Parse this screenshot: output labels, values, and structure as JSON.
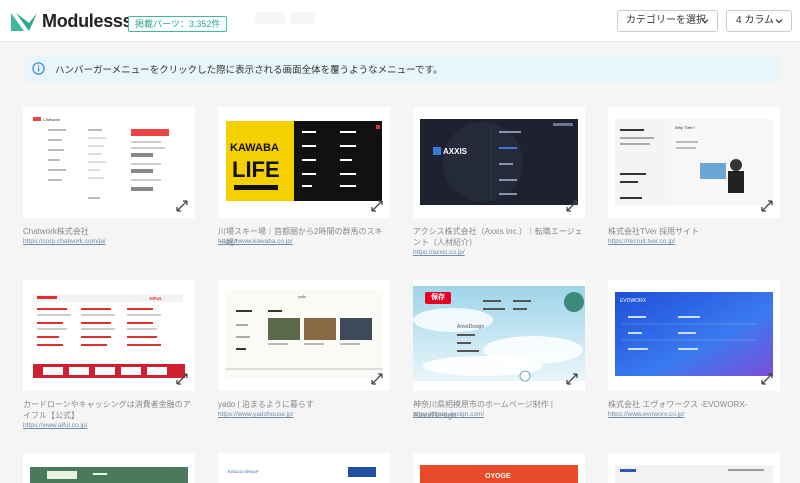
{
  "header": {
    "logo": "Modulesss...",
    "count_badge": "掲載パーツ：3,352件",
    "category_select": "カテゴリーを選択",
    "columns_select": "4 カラム"
  },
  "info": {
    "text": "ハンバーガーメニューをクリックした際に表示される画面全体を覆うようなメニューです。"
  },
  "cards": [
    {
      "title": "Chatwork株式会社",
      "url": "https://corp.chatwork.com/ja/",
      "thumb_label": "Chatwork"
    },
    {
      "title": "川場スキー場｜首都圏から2時間の群馬のスキー場！",
      "url": "https://www.kawaba.co.jp/",
      "thumb_label": "KAWABA LIFE"
    },
    {
      "title": "アクシス株式会社（Axxis Inc.）｜転職エージェント（人材紹介）",
      "url": "https://axxis.co.jp/",
      "thumb_label": "AXXIS"
    },
    {
      "title": "株式会社TVer 採用サイト",
      "url": "https://recruit.tver.co.jp/",
      "thumb_label": "Why TVer?"
    },
    {
      "title": "カードローンやキャッシングは消費者金融のアイフル【公式】",
      "url": "https://www.aiful.co.jp/",
      "thumb_label": "AIFUL"
    },
    {
      "title": "yado | 泊まるように暮らす",
      "url": "https://www.yadohouse.jp/",
      "thumb_label": "yado"
    },
    {
      "title": "神奈川県相模原市のホームページ制作 | AmotDesign",
      "url": "https://amot-design.com/",
      "thumb_label": "AmotDesign",
      "pin_label": "保存"
    },
    {
      "title": "株式会社 エヴォワークス -EVOWORX-",
      "url": "https://www.evoworx.co.jp/",
      "thumb_label": "EVOWORX"
    },
    {
      "title": "",
      "url": "",
      "thumb_label": ""
    },
    {
      "title": "",
      "url": "",
      "thumb_label": "KITAGO GROUP"
    },
    {
      "title": "",
      "url": "",
      "thumb_label": "OYOGE"
    },
    {
      "title": "",
      "url": "",
      "thumb_label": ""
    }
  ],
  "colors": {
    "accent": "#3cb9a0",
    "info_bg": "#e8f5fb",
    "link": "#6b8fb0"
  },
  "icons": [
    "logo-mark-icon",
    "chevron-down-icon",
    "info-icon",
    "expand-icon"
  ]
}
